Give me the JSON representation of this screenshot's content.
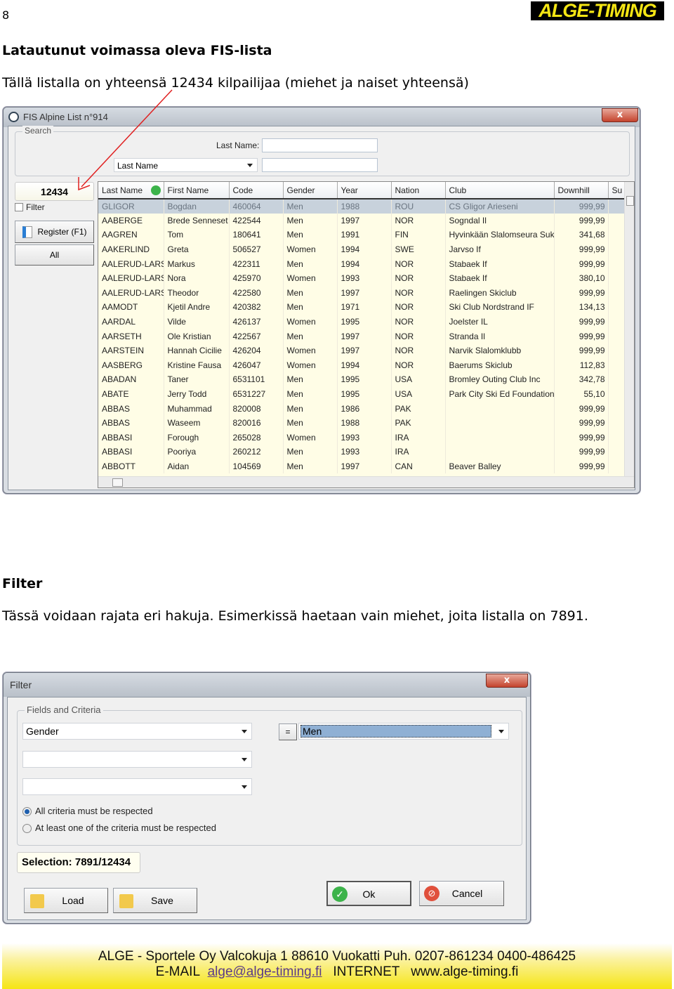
{
  "page": {
    "number": "8",
    "logo": "ALGE-TIMING",
    "heading1": "Latautunut voimassa oleva FIS-lista",
    "para1": "Tällä listalla on yhteensä 12434 kilpailijaa (miehet ja naiset yhteensä)",
    "heading2": "Filter",
    "para2": "Tässä voidaan rajata eri hakuja. Esimerkissä haetaan vain miehet, joita listalla on 7891.",
    "annotation_color": "#e02020"
  },
  "fis_window": {
    "title": "FIS Alpine List n°914",
    "close": "x",
    "search": {
      "group": "Search",
      "last_name_label": "Last Name:",
      "last_name_value": "",
      "field_combo": "Last Name",
      "field_value": ""
    },
    "count": "12434",
    "filter_label": "Filter",
    "filter_checked": false,
    "register_button": "Register (F1)",
    "all_button": "All",
    "columns": [
      "Last Name",
      "First Name",
      "Code",
      "Gender",
      "Year",
      "Nation",
      "Club",
      "Downhill",
      "Su"
    ],
    "rows": [
      [
        "GLIGOR",
        "Bogdan",
        "460064",
        "Men",
        "1988",
        "ROU",
        "CS Gligor Arieseni",
        "999,99",
        ""
      ],
      [
        "AABERGE",
        "Brede Senneset",
        "422544",
        "Men",
        "1997",
        "NOR",
        "Sogndal Il",
        "999,99",
        ""
      ],
      [
        "AAGREN",
        "Tom",
        "180641",
        "Men",
        "1991",
        "FIN",
        "Hyvinkään Slalomseura Sukku",
        "341,68",
        ""
      ],
      [
        "AAKERLIND",
        "Greta",
        "506527",
        "Women",
        "1994",
        "SWE",
        "Jarvso If",
        "999,99",
        ""
      ],
      [
        "AALERUD-LARSEN",
        "Markus",
        "422311",
        "Men",
        "1994",
        "NOR",
        "Stabaek If",
        "999,99",
        ""
      ],
      [
        "AALERUD-LARSEN",
        "Nora",
        "425970",
        "Women",
        "1993",
        "NOR",
        "Stabaek If",
        "380,10",
        ""
      ],
      [
        "AALERUD-LARSEN",
        "Theodor",
        "422580",
        "Men",
        "1997",
        "NOR",
        "Raelingen Skiclub",
        "999,99",
        ""
      ],
      [
        "AAMODT",
        "Kjetil Andre",
        "420382",
        "Men",
        "1971",
        "NOR",
        "Ski Club Nordstrand IF",
        "134,13",
        ""
      ],
      [
        "AARDAL",
        "Vilde",
        "426137",
        "Women",
        "1995",
        "NOR",
        "Joelster IL",
        "999,99",
        ""
      ],
      [
        "AARSETH",
        "Ole Kristian",
        "422567",
        "Men",
        "1997",
        "NOR",
        "Stranda Il",
        "999,99",
        ""
      ],
      [
        "AARSTEIN",
        "Hannah Cicilie",
        "426204",
        "Women",
        "1997",
        "NOR",
        "Narvik Slalomklubb",
        "999,99",
        ""
      ],
      [
        "AASBERG",
        "Kristine Fausa",
        "426047",
        "Women",
        "1994",
        "NOR",
        "Baerums Skiclub",
        "112,83",
        ""
      ],
      [
        "ABADAN",
        "Taner",
        "6531101",
        "Men",
        "1995",
        "USA",
        "Bromley Outing Club Inc",
        "342,78",
        ""
      ],
      [
        "ABATE",
        "Jerry Todd",
        "6531227",
        "Men",
        "1995",
        "USA",
        "Park City Ski Ed Foundation",
        "55,10",
        ""
      ],
      [
        "ABBAS",
        "Muhammad",
        "820008",
        "Men",
        "1986",
        "PAK",
        "",
        "999,99",
        ""
      ],
      [
        "ABBAS",
        "Waseem",
        "820016",
        "Men",
        "1988",
        "PAK",
        "",
        "999,99",
        ""
      ],
      [
        "ABBASI",
        "Forough",
        "265028",
        "Women",
        "1993",
        "IRA",
        "",
        "999,99",
        ""
      ],
      [
        "ABBASI",
        "Pooriya",
        "260212",
        "Men",
        "1993",
        "IRA",
        "",
        "999,99",
        ""
      ],
      [
        "ABBOTT",
        "Aidan",
        "104569",
        "Men",
        "1997",
        "CAN",
        "Beaver Balley",
        "999,99",
        ""
      ]
    ]
  },
  "filter_window": {
    "title": "Filter",
    "close": "x",
    "group": "Fields and Criteria",
    "field1": "Gender",
    "operator": "=",
    "value1": "Men",
    "field2": "",
    "field3": "",
    "radio_all": "All criteria must be respected",
    "radio_one": "At least one of the criteria must be respected",
    "selected_radio": "all",
    "selection": "Selection: 7891/12434",
    "load": "Load",
    "save": "Save",
    "ok": "Ok",
    "cancel": "Cancel"
  },
  "footer": {
    "line1": "ALGE - Sportele Oy Valcokuja 1 88610 Vuokatti  Puh. 0207-861234  0400-486425",
    "email_label": "E-MAIL",
    "email": "alge@alge-timing.fi",
    "internet_label": "INTERNET",
    "web": "www.alge-timing.fi"
  }
}
